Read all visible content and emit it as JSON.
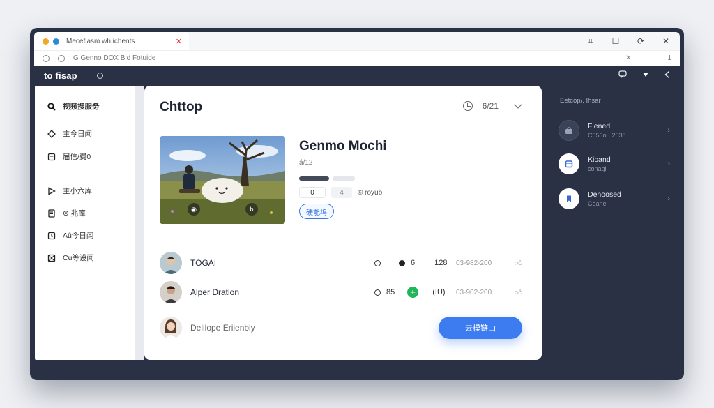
{
  "browser": {
    "tab_title": "Mecefiasm wh ichents",
    "address": "G Genno DOX Bid Fotuide",
    "address_num": "1",
    "controls": [
      "⌗",
      "☐",
      "⟳",
      "✕"
    ]
  },
  "app": {
    "title": "to fisap"
  },
  "sidebar": {
    "items": [
      {
        "icon": "search-icon",
        "label": "视频搜服务",
        "active": true
      },
      {
        "icon": "diamond-icon",
        "label": "主今日闻"
      },
      {
        "icon": "page-icon",
        "label": "届信/费0"
      },
      {
        "icon": "play-icon",
        "label": "主小六库"
      },
      {
        "icon": "doc-icon",
        "label": "⊚ 兆库"
      },
      {
        "icon": "calendar-icon",
        "label": "Aû今日闻"
      },
      {
        "icon": "image-icon",
        "label": "Cu等设闻"
      }
    ]
  },
  "main": {
    "title": "Chttop",
    "date": "6/21",
    "product": {
      "title": "Genmo Mochi",
      "subtitle": "á/12",
      "progress": 0.57,
      "stat_a": "0",
      "stat_b": "4",
      "stat_label": "© royub",
      "button": "硬能坞"
    },
    "rows": [
      {
        "name": "TOGAI",
        "s1": "",
        "s2": "6",
        "s3": "128",
        "date": "03-982-200"
      },
      {
        "name": "Alper Dration",
        "s1": "85",
        "s2": "",
        "s3": "(IU)",
        "date": "03-902-200"
      },
      {
        "name": "Delilope Eriienbly"
      }
    ],
    "cta": "去模链山"
  },
  "right_panel": {
    "title": "Eetcop/. Ihsar",
    "items": [
      {
        "name": "Flened",
        "sub": "C656o · 2038"
      },
      {
        "name": "Kioand",
        "sub": "conagil"
      },
      {
        "name": "Denoosed",
        "sub": "Coanel"
      }
    ]
  }
}
